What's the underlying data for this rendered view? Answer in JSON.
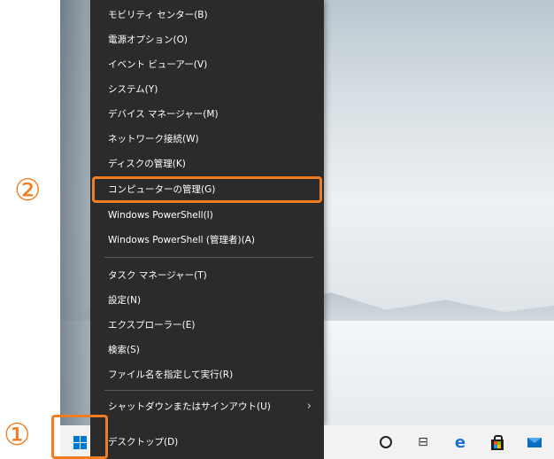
{
  "menu": {
    "items": [
      {
        "label": "モビリティ センター(B)"
      },
      {
        "label": "電源オプション(O)"
      },
      {
        "label": "イベント ビューアー(V)"
      },
      {
        "label": "システム(Y)"
      },
      {
        "label": "デバイス マネージャー(M)"
      },
      {
        "label": "ネットワーク接続(W)"
      },
      {
        "label": "ディスクの管理(K)"
      },
      {
        "label": "コンピューターの管理(G)"
      },
      {
        "label": "Windows PowerShell(I)"
      },
      {
        "label": "Windows PowerShell (管理者)(A)"
      },
      {
        "label": "タスク マネージャー(T)"
      },
      {
        "label": "設定(N)"
      },
      {
        "label": "エクスプローラー(E)"
      },
      {
        "label": "検索(S)"
      },
      {
        "label": "ファイル名を指定して実行(R)"
      },
      {
        "label": "シャットダウンまたはサインアウト(U)"
      },
      {
        "label": "デスクトップ(D)"
      }
    ],
    "submenu_arrow": "›"
  },
  "steps": {
    "step1": "①",
    "step2": "②"
  },
  "taskbar": {
    "icons": [
      "windows-start-icon",
      "cortana-icon",
      "task-view-icon",
      "edge-icon",
      "store-icon",
      "mail-icon"
    ],
    "taskview_glyph": "⊟",
    "edge_glyph": "e"
  },
  "colors": {
    "menu_bg": "#2b2b2b",
    "highlight": "#f07d22",
    "windows_blue": "#0078d7"
  }
}
